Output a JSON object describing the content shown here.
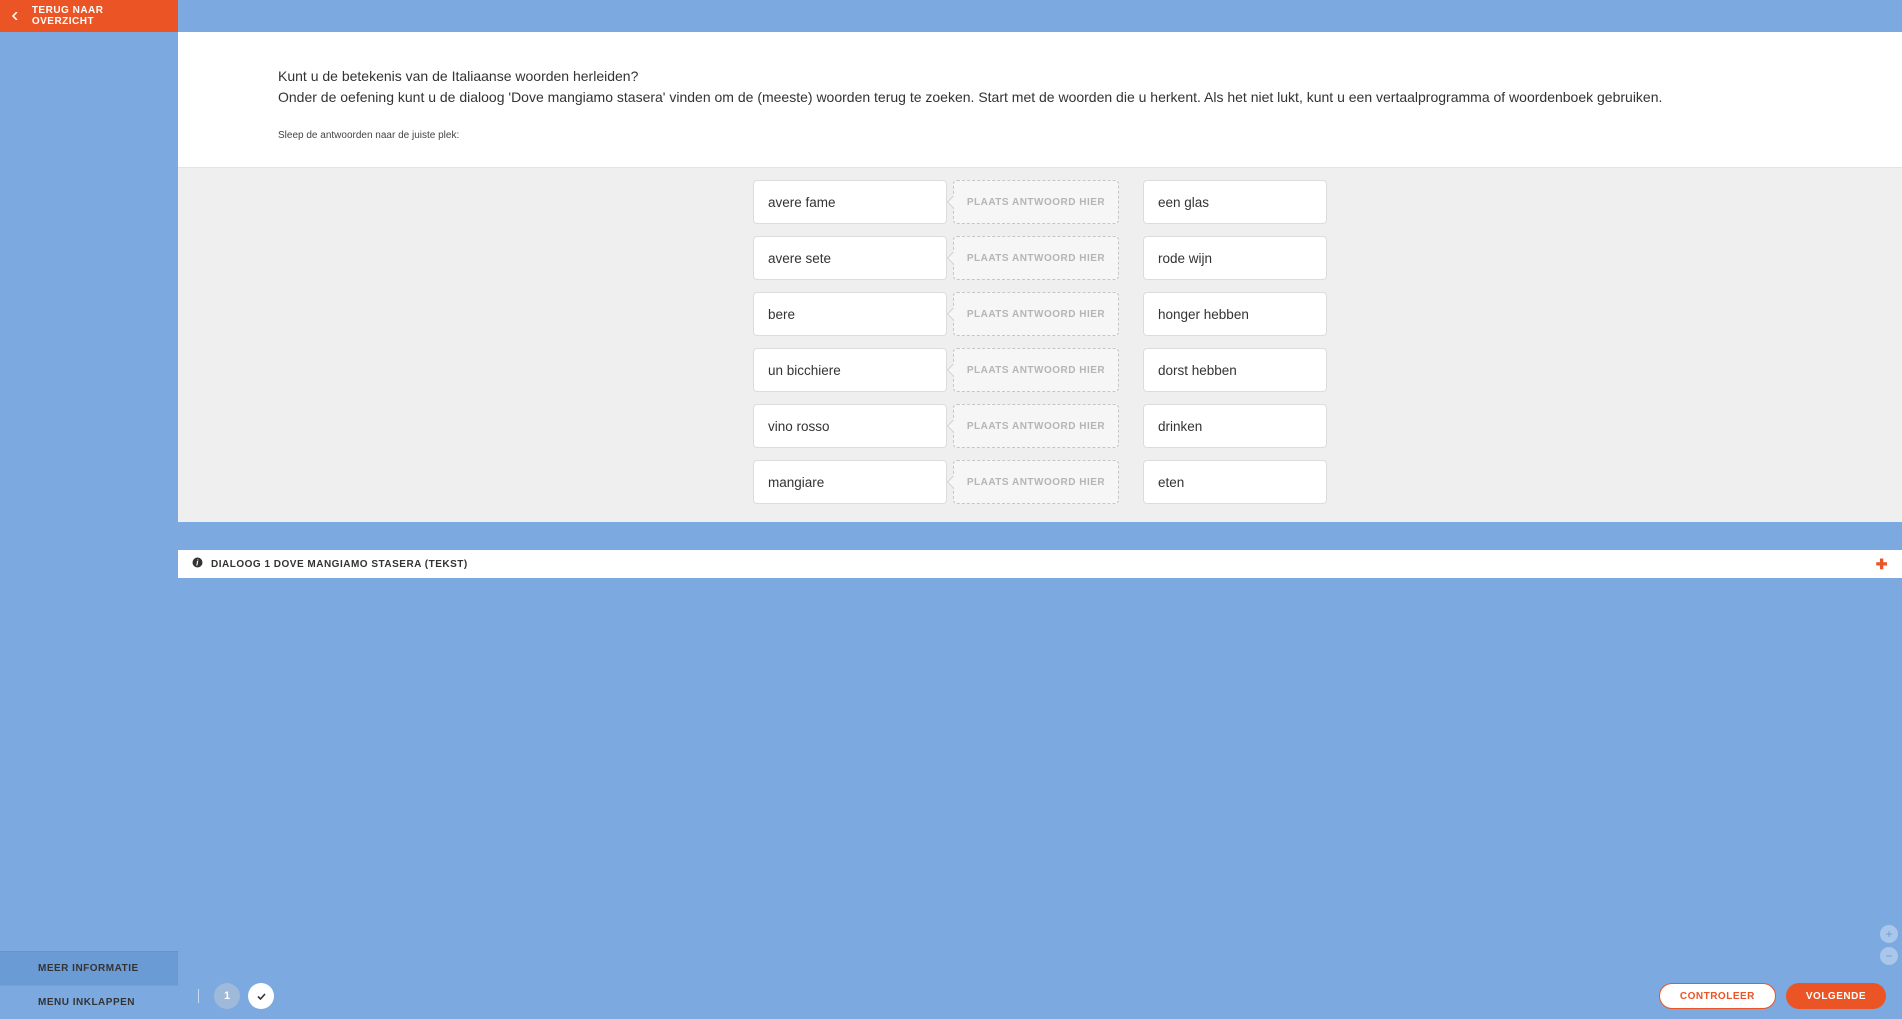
{
  "sidebar": {
    "back_label": "TERUG NAAR OVERZICHT",
    "more_info_label": "MEER INFORMATIE",
    "collapse_label": "MENU INKLAPPEN"
  },
  "intro": {
    "line1": "Kunt u de betekenis van de Italiaanse woorden herleiden?",
    "line2": "Onder de oefening kunt u de dialoog 'Dove mangiamo stasera' vinden om de (meeste) woorden terug te zoeken. Start met de woorden die u herkent. Als het niet lukt, kunt u een vertaalprogramma of woordenboek gebruiken.",
    "hint": "Sleep de antwoorden naar de juiste plek:"
  },
  "exercise": {
    "drop_placeholder": "PLAATS ANTWOORD HIER",
    "source_words": [
      "avere fame",
      "avere sete",
      "bere",
      "un bicchiere",
      "vino rosso",
      "mangiare"
    ],
    "answer_options": [
      "een glas",
      "rode wijn",
      "honger hebben",
      "dorst hebben",
      "drinken",
      "eten"
    ]
  },
  "accordion": {
    "title": "DIALOOG 1 DOVE MANGIAMO STASERA (TEKST)"
  },
  "footer": {
    "step_number": "1",
    "check_label": "CONTROLEER",
    "next_label": "VOLGENDE"
  }
}
